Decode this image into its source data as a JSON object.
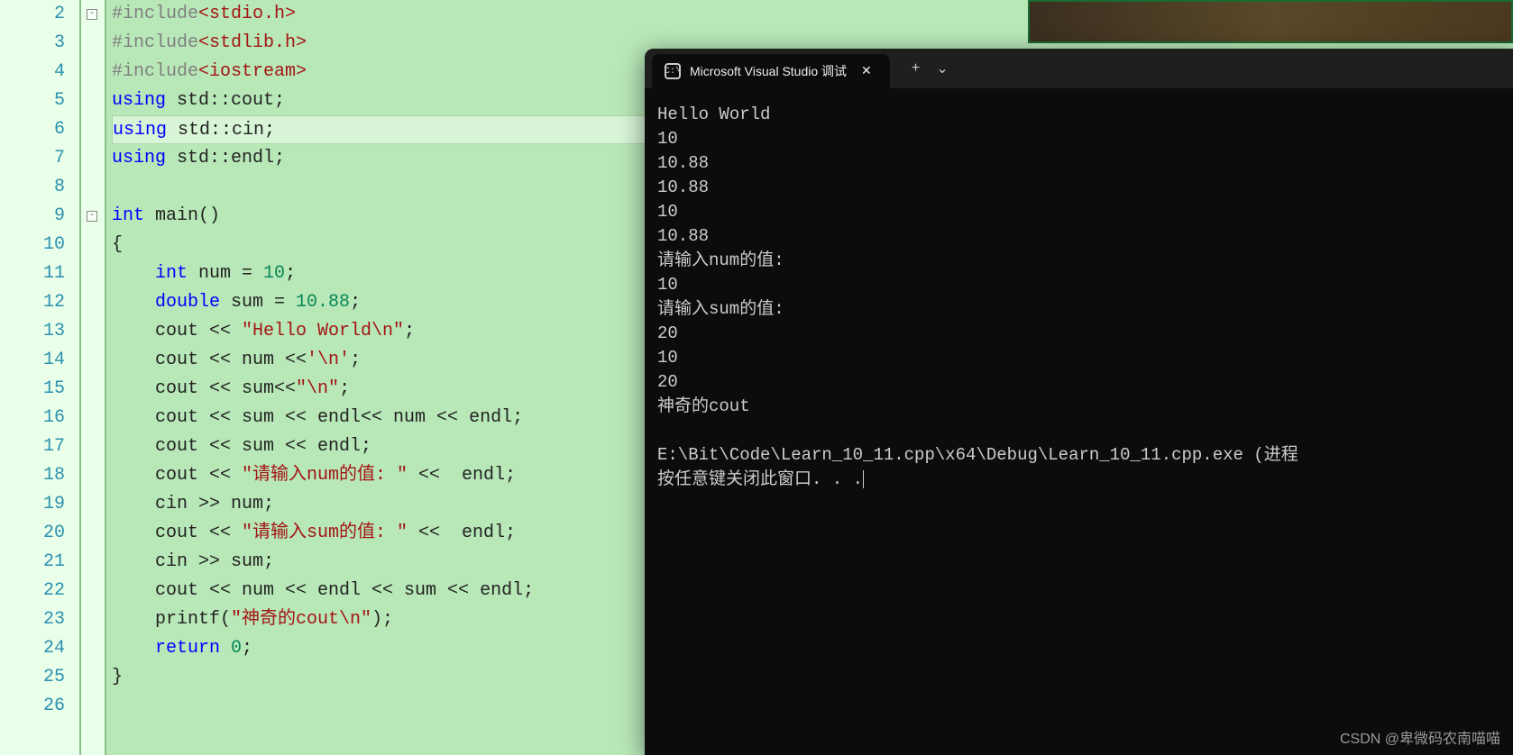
{
  "editor": {
    "line_numbers": [
      "2",
      "3",
      "4",
      "5",
      "6",
      "7",
      "8",
      "9",
      "10",
      "11",
      "12",
      "13",
      "14",
      "15",
      "16",
      "17",
      "18",
      "19",
      "20",
      "21",
      "22",
      "23",
      "24",
      "25",
      "26"
    ],
    "current_line_index": 4,
    "fold_marks": [
      0,
      7
    ],
    "lines": [
      [
        {
          "cls": "pp",
          "t": "#include"
        },
        {
          "cls": "ang",
          "t": "<stdio.h>"
        }
      ],
      [
        {
          "cls": "pp",
          "t": "#include"
        },
        {
          "cls": "ang",
          "t": "<stdlib.h>"
        }
      ],
      [
        {
          "cls": "pp",
          "t": "#include"
        },
        {
          "cls": "ang",
          "t": "<iostream>"
        }
      ],
      [
        {
          "cls": "kw",
          "t": "using "
        },
        {
          "cls": "",
          "t": "std::cout;"
        }
      ],
      [
        {
          "cls": "kw",
          "t": "using "
        },
        {
          "cls": "",
          "t": "std::cin;"
        }
      ],
      [
        {
          "cls": "kw",
          "t": "using "
        },
        {
          "cls": "",
          "t": "std::endl;"
        }
      ],
      [],
      [
        {
          "cls": "kw",
          "t": "int "
        },
        {
          "cls": "fn",
          "t": "main"
        },
        {
          "cls": "",
          "t": "()"
        }
      ],
      [
        {
          "cls": "",
          "t": "{"
        }
      ],
      [
        {
          "cls": "",
          "t": "    "
        },
        {
          "cls": "kw",
          "t": "int "
        },
        {
          "cls": "",
          "t": "num = "
        },
        {
          "cls": "num",
          "t": "10"
        },
        {
          "cls": "",
          "t": ";"
        }
      ],
      [
        {
          "cls": "",
          "t": "    "
        },
        {
          "cls": "kw",
          "t": "double "
        },
        {
          "cls": "",
          "t": "sum = "
        },
        {
          "cls": "num",
          "t": "10.88"
        },
        {
          "cls": "",
          "t": ";"
        }
      ],
      [
        {
          "cls": "",
          "t": "    cout << "
        },
        {
          "cls": "str",
          "t": "\"Hello World\\n\""
        },
        {
          "cls": "",
          "t": ";"
        }
      ],
      [
        {
          "cls": "",
          "t": "    cout << num <<"
        },
        {
          "cls": "str",
          "t": "'\\n'"
        },
        {
          "cls": "",
          "t": ";"
        }
      ],
      [
        {
          "cls": "",
          "t": "    cout << sum<<"
        },
        {
          "cls": "str",
          "t": "\"\\n\""
        },
        {
          "cls": "",
          "t": ";"
        }
      ],
      [
        {
          "cls": "",
          "t": "    cout << sum << endl<< num << endl;"
        }
      ],
      [
        {
          "cls": "",
          "t": "    cout << sum << endl;"
        }
      ],
      [
        {
          "cls": "",
          "t": "    cout << "
        },
        {
          "cls": "str",
          "t": "\"请输入num的值: \""
        },
        {
          "cls": "",
          "t": " <<  endl;"
        }
      ],
      [
        {
          "cls": "",
          "t": "    cin >> num;"
        }
      ],
      [
        {
          "cls": "",
          "t": "    cout << "
        },
        {
          "cls": "str",
          "t": "\"请输入sum的值: \""
        },
        {
          "cls": "",
          "t": " <<  endl;"
        }
      ],
      [
        {
          "cls": "",
          "t": "    cin >> sum;"
        }
      ],
      [
        {
          "cls": "",
          "t": "    cout << num << endl << sum << endl;"
        }
      ],
      [
        {
          "cls": "",
          "t": "    printf("
        },
        {
          "cls": "str",
          "t": "\"神奇的cout\\n\""
        },
        {
          "cls": "",
          "t": ");"
        }
      ],
      [
        {
          "cls": "",
          "t": "    "
        },
        {
          "cls": "kw",
          "t": "return "
        },
        {
          "cls": "num",
          "t": "0"
        },
        {
          "cls": "",
          "t": ";"
        }
      ],
      [
        {
          "cls": "",
          "t": "}"
        }
      ],
      []
    ]
  },
  "terminal": {
    "tab_title": "Microsoft Visual Studio 调试",
    "tab_icon_text": "C:\\",
    "new_tab": "+",
    "dropdown": "⌄",
    "close": "✕",
    "output": [
      "Hello World",
      "10",
      "10.88",
      "10.88",
      "10",
      "10.88",
      "请输入num的值:",
      "10",
      "请输入sum的值:",
      "20",
      "10",
      "20",
      "神奇的cout",
      "",
      "E:\\Bit\\Code\\Learn_10_11.cpp\\x64\\Debug\\Learn_10_11.cpp.exe (进程 ",
      "按任意键关闭此窗口. . ."
    ]
  },
  "watermark": "CSDN @卑微码农南喵喵"
}
